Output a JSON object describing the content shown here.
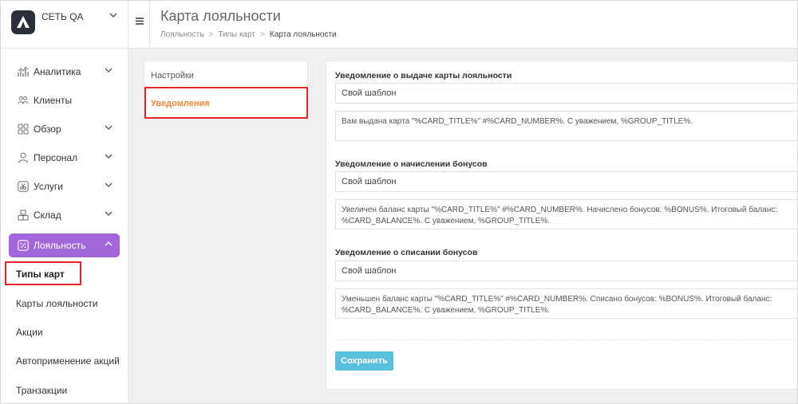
{
  "brand": {
    "name": "СЕТЬ QA"
  },
  "header": {
    "title": "Карта лояльности",
    "breadcrumb": [
      "Лояльность",
      "Типы карт",
      "Карта лояльности"
    ]
  },
  "sidebar": {
    "items": [
      {
        "label": "Аналитика",
        "icon": "chart-icon",
        "has_chevron": true
      },
      {
        "label": "Клиенты",
        "icon": "users-icon",
        "has_chevron": false
      },
      {
        "label": "Обзор",
        "icon": "grid-icon",
        "has_chevron": true
      },
      {
        "label": "Персонал",
        "icon": "person-icon",
        "has_chevron": true
      },
      {
        "label": "Услуги",
        "icon": "scissors-icon",
        "has_chevron": true
      },
      {
        "label": "Склад",
        "icon": "boxes-icon",
        "has_chevron": true
      },
      {
        "label": "Лояльность",
        "icon": "percent-icon",
        "has_chevron": true,
        "active": true
      }
    ],
    "sub_items": [
      {
        "label": "Типы карт",
        "active": true
      },
      {
        "label": "Карты лояльности"
      },
      {
        "label": "Акции"
      },
      {
        "label": "Автоприменение акций"
      },
      {
        "label": "Транзакции"
      }
    ]
  },
  "tabs": [
    {
      "label": "Настройки"
    },
    {
      "label": "Уведомления",
      "active": true
    }
  ],
  "form": {
    "sections": [
      {
        "label": "Уведомление о выдаче карты лояльности",
        "template": "Свой шаблон",
        "text": "Вам выдана карта \"%CARD_TITLE%\" #%CARD_NUMBER%. С уважением, %GROUP_TITLE%."
      },
      {
        "label": "Уведомление о начислении бонусов",
        "template": "Свой шаблон",
        "text": "Увеличен баланс карты \"%CARD_TITLE%\" #%CARD_NUMBER%. Начислено бонусов: %BONUS%. Итоговый баланс: %CARD_BALANCE%. С уважением, %GROUP_TITLE%."
      },
      {
        "label": "Уведомление о списании бонусов",
        "template": "Свой шаблон",
        "text": "Уменьшен баланс карты \"%CARD_TITLE%\" #%CARD_NUMBER%. Списано бонусов: %BONUS%. Итоговый баланс: %CARD_BALANCE%. С уважением, %GROUP_TITLE%."
      }
    ],
    "save_label": "Сохранить"
  },
  "colors": {
    "accent_purple": "#a367dc",
    "active_tab_orange": "#f08a3c",
    "save_button": "#5bc0de",
    "highlight_red": "#e8202a"
  }
}
